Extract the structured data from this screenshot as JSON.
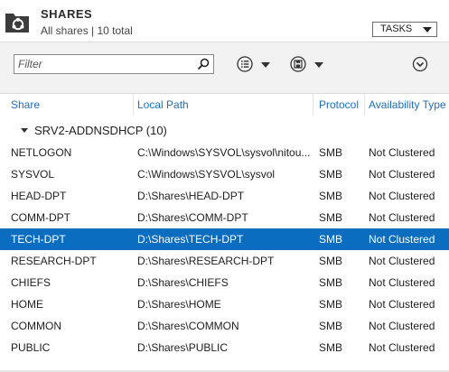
{
  "header": {
    "title": "SHARES",
    "subtitle": "All shares | 10 total",
    "tasks_label": "TASKS"
  },
  "toolbar": {
    "filter_placeholder": "Filter",
    "filter_value": ""
  },
  "columns": {
    "share": "Share",
    "local_path": "Local Path",
    "protocol": "Protocol",
    "availability": "Availability Type"
  },
  "group": {
    "label": "SRV2-ADDNSDHCP (10)"
  },
  "rows": [
    {
      "share": "NETLOGON",
      "path": "C:\\Windows\\SYSVOL\\sysvol\\nitou...",
      "protocol": "SMB",
      "availability": "Not Clustered"
    },
    {
      "share": "SYSVOL",
      "path": "C:\\Windows\\SYSVOL\\sysvol",
      "protocol": "SMB",
      "availability": "Not Clustered"
    },
    {
      "share": "HEAD-DPT",
      "path": "D:\\Shares\\HEAD-DPT",
      "protocol": "SMB",
      "availability": "Not Clustered"
    },
    {
      "share": "COMM-DPT",
      "path": "D:\\Shares\\COMM-DPT",
      "protocol": "SMB",
      "availability": "Not Clustered"
    },
    {
      "share": "TECH-DPT",
      "path": "D:\\Shares\\TECH-DPT",
      "protocol": "SMB",
      "availability": "Not Clustered"
    },
    {
      "share": "RESEARCH-DPT",
      "path": "D:\\Shares\\RESEARCH-DPT",
      "protocol": "SMB",
      "availability": "Not Clustered"
    },
    {
      "share": "CHIEFS",
      "path": "D:\\Shares\\CHIEFS",
      "protocol": "SMB",
      "availability": "Not Clustered"
    },
    {
      "share": "HOME",
      "path": "D:\\Shares\\HOME",
      "protocol": "SMB",
      "availability": "Not Clustered"
    },
    {
      "share": "COMMON",
      "path": "D:\\Shares\\COMMON",
      "protocol": "SMB",
      "availability": "Not Clustered"
    },
    {
      "share": "PUBLIC",
      "path": "D:\\Shares\\PUBLIC",
      "protocol": "SMB",
      "availability": "Not Clustered"
    }
  ],
  "selected_share": "TECH-DPT",
  "colors": {
    "selection": "#0b6dc0",
    "column_header": "#1e6fb9",
    "toolbar_bg": "#f2f2f2"
  },
  "icons": {
    "header": "shares-icon",
    "search": "search-icon",
    "view": "list-view-icon",
    "save": "save-icon",
    "expand": "expand-icon"
  }
}
